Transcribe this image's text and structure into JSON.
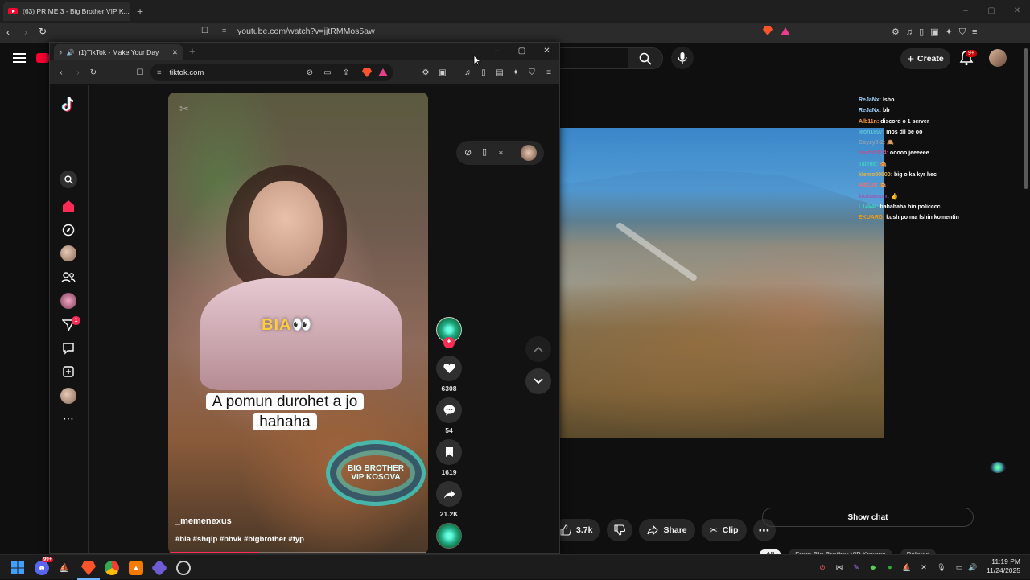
{
  "back_browser": {
    "tab_title": "(63) PRIME 3 - Big Brother VIP K...",
    "url": "youtube.com/watch?v=jjtRMMos5aw",
    "window_controls": [
      "–",
      "▢",
      "✕"
    ]
  },
  "youtube": {
    "create_label": "Create",
    "notification_badge": "9+",
    "chat_messages": [
      {
        "user": "ReJaNx:",
        "text": "lsho",
        "color": "#9fd3ff"
      },
      {
        "user": "ReJaNx:",
        "text": "bb",
        "color": "#9fd3ff"
      },
      {
        "user": "Alb11n:",
        "text": "discord o 1 server",
        "color": "#ff9a3c"
      },
      {
        "user": "leon1807:",
        "text": "mos dil be oo",
        "color": "#5fc4d9"
      },
      {
        "user": "Coyzy0-2:",
        "text": "🙈",
        "color": "#8fa1b3"
      },
      {
        "user": "bastri2914:",
        "text": "ooooo jeeeeee",
        "color": "#c94c8a"
      },
      {
        "user": "Talenti:",
        "text": "🙈",
        "color": "#3fd0c0"
      },
      {
        "user": "klemo00000:",
        "text": "big o ka kyr hec",
        "color": "#e0b44c"
      },
      {
        "user": "Albi1n:",
        "text": "🙈",
        "color": "#ff6b6b"
      },
      {
        "user": "kiolsamurr:",
        "text": "👍",
        "color": "#9b59b6"
      },
      {
        "user": "L14k4t:",
        "text": "hahahaha hin policccc",
        "color": "#3fd0c0"
      },
      {
        "user": "EKUARD:",
        "text": "kush po ma fshin komentin",
        "color": "#f39c12"
      }
    ],
    "likes": "3.7k",
    "share_label": "Share",
    "clip_label": "Clip",
    "show_chat": "Show chat",
    "chips": [
      "All",
      "From Big Brother VIP Kosova",
      "Related"
    ]
  },
  "tiktok_window": {
    "tab_title": "(1)TikTok - Make Your Day",
    "url": "tiktok.com",
    "window_controls": [
      "–",
      "▢",
      "✕"
    ],
    "sidebar_badge": "1",
    "video": {
      "overlay_text": "BIA👀",
      "caption": "A pomun durohet a jo hahaha",
      "logo_text_line1": "BIG BROTHER",
      "logo_text_line2": "VIP KOSOVA",
      "username": "_memenexus",
      "hashtags": "#bia #shqip #bbvk #bigbrother #fyp",
      "progress_fraction": 0.35
    },
    "actions": {
      "follow": "+",
      "likes": "6308",
      "comments": "54",
      "saves": "1619",
      "shares": "21.2K"
    }
  },
  "taskbar": {
    "time": "11:19 PM",
    "date": "11/24/2025",
    "discord_badge": "99+"
  }
}
